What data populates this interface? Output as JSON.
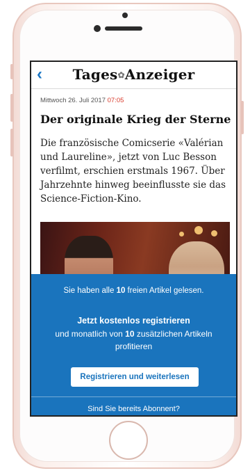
{
  "header": {
    "back_icon": "‹",
    "brand": "Tages",
    "brand_ornament": "✿",
    "brand_end": "Anzeiger"
  },
  "article": {
    "date": "Mittwoch 26. Juli 2017",
    "time": "07:05",
    "title": "Der originale Krieg der Sterne",
    "lead": "Die französische Comicserie «Valérian und Laureline», jetzt von Luc Besson verfilmt, erschien erstmals 1967. Über Jahrzehnte hinweg beeinflusste sie das Science-Fiction-Kino."
  },
  "paywall": {
    "line1_pre": "Sie haben alle ",
    "line1_num": "10",
    "line1_post": " freien Artikel gelesen.",
    "headline": "Jetzt kostenlos registrieren",
    "line3_pre": "und monatlich von ",
    "line3_num": "10",
    "line3_post": " zusätzlichen Artikeln profitieren",
    "cta_label": "Registrieren und weiterlesen",
    "subscriber_link": "Sind Sie bereits Abonnent?"
  },
  "colors": {
    "accent": "#1a74bd",
    "time_red": "#d93a2b"
  }
}
